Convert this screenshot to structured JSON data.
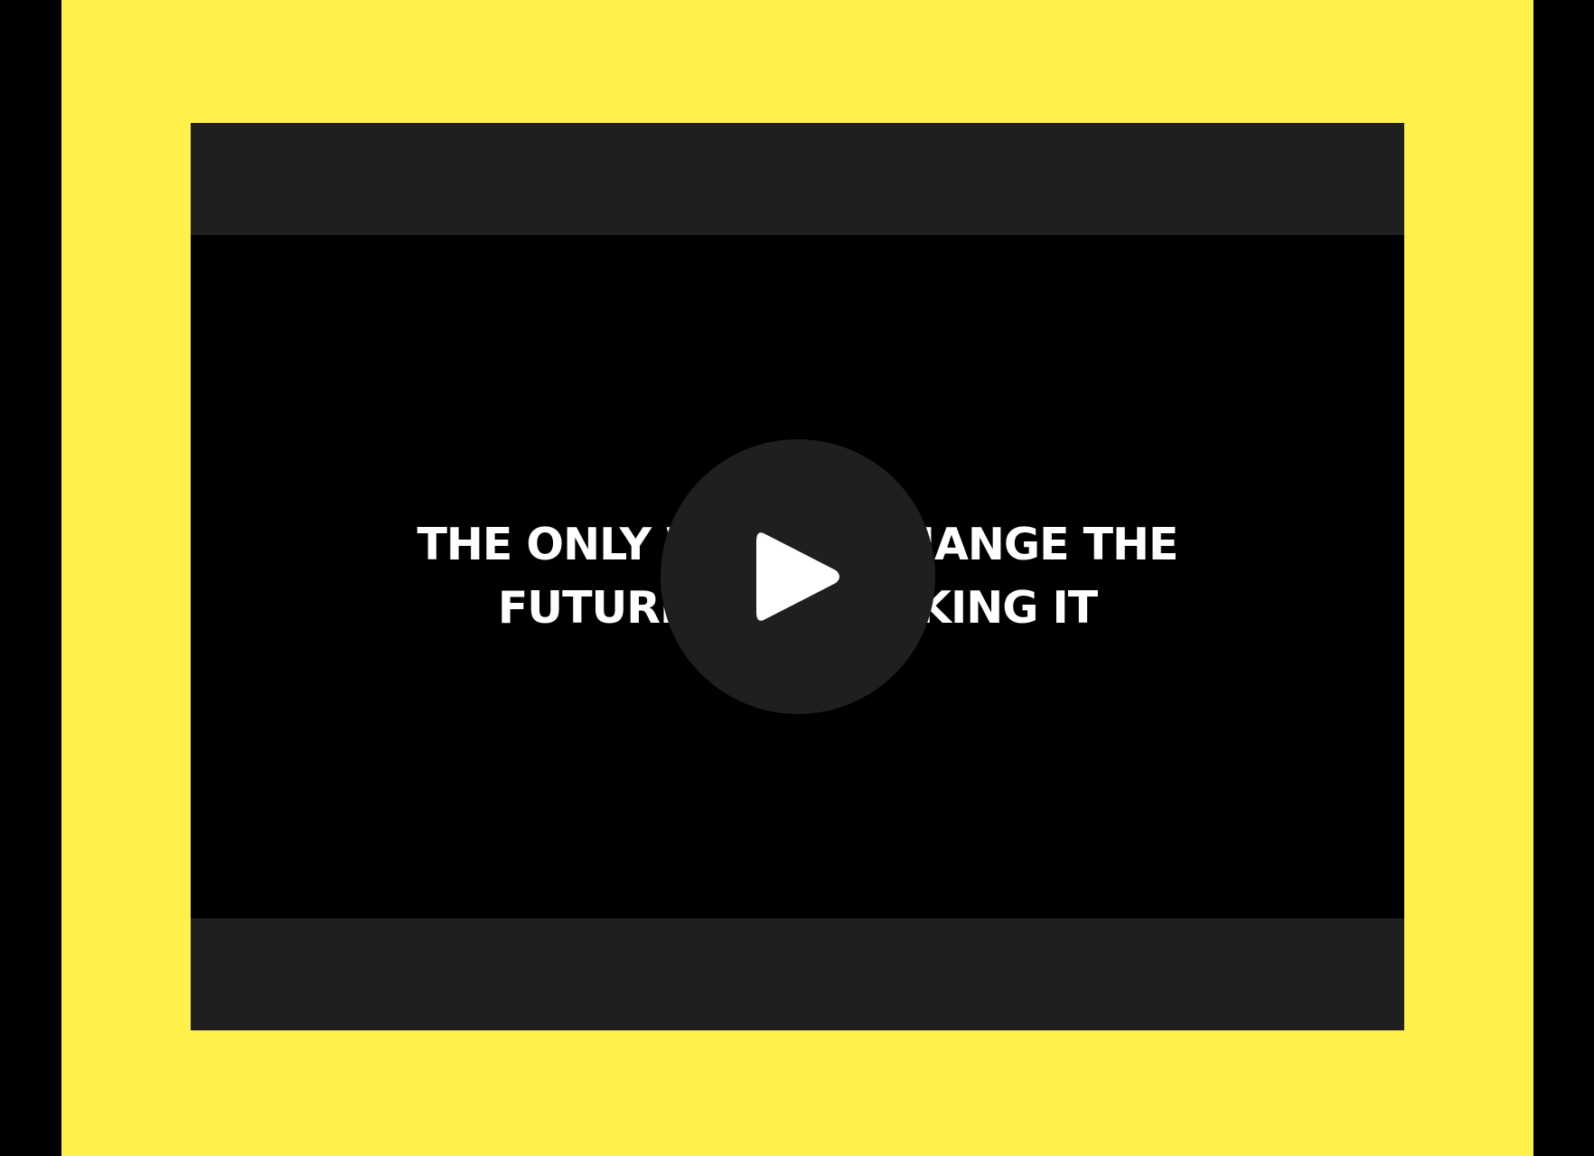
{
  "video": {
    "caption_line1": "THE ONLY WAY TO CHANGE THE",
    "caption_line2": "FUTURE IS BY MAKING IT",
    "play_button_label": "Play video",
    "play_icon": "play-icon"
  },
  "colors": {
    "frame_background": "#FFF04A",
    "page_background": "#000000",
    "player_background": "#1F1F1F",
    "video_background": "#000000",
    "caption_color": "#FFFFFF"
  }
}
